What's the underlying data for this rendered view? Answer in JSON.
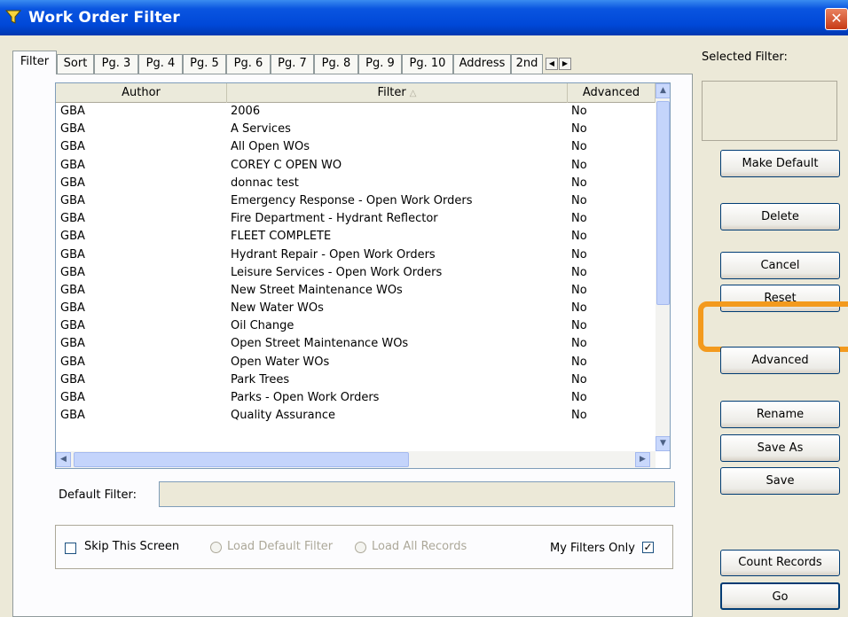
{
  "window": {
    "title": "Work Order Filter",
    "close_glyph": "✕"
  },
  "tabs": [
    "Filter",
    "Sort",
    "Pg. 3",
    "Pg. 4",
    "Pg. 5",
    "Pg. 6",
    "Pg. 7",
    "Pg. 8",
    "Pg. 9",
    "Pg. 10",
    "Address",
    "2nd"
  ],
  "active_tab": "Filter",
  "tab_scroll": {
    "left": "◀",
    "right": "▶"
  },
  "grid": {
    "columns": [
      "Author",
      "Filter",
      "Advanced"
    ],
    "sort_indicator": "△",
    "rows": [
      [
        "GBA",
        "2006",
        "No"
      ],
      [
        "GBA",
        "A Services",
        "No"
      ],
      [
        "GBA",
        "All Open WOs",
        "No"
      ],
      [
        "GBA",
        "COREY C OPEN WO",
        "No"
      ],
      [
        "GBA",
        "donnac test",
        "No"
      ],
      [
        "GBA",
        "Emergency Response - Open Work Orders",
        "No"
      ],
      [
        "GBA",
        "Fire Department - Hydrant Reflector",
        "No"
      ],
      [
        "GBA",
        "FLEET COMPLETE",
        "No"
      ],
      [
        "GBA",
        "Hydrant Repair - Open Work Orders",
        "No"
      ],
      [
        "GBA",
        "Leisure Services - Open Work Orders",
        "No"
      ],
      [
        "GBA",
        "New Street Maintenance WOs",
        "No"
      ],
      [
        "GBA",
        "New Water WOs",
        "No"
      ],
      [
        "GBA",
        "Oil Change",
        "No"
      ],
      [
        "GBA",
        "Open Street Maintenance WOs",
        "No"
      ],
      [
        "GBA",
        "Open Water WOs",
        "No"
      ],
      [
        "GBA",
        "Park Trees",
        "No"
      ],
      [
        "GBA",
        "Parks - Open Work Orders",
        "No"
      ],
      [
        "GBA",
        "Quality Assurance",
        "No"
      ]
    ]
  },
  "scroll_glyphs": {
    "up": "▲",
    "down": "▼",
    "left": "◀",
    "right": "▶"
  },
  "default_filter": {
    "label": "Default Filter:",
    "value": ""
  },
  "options": {
    "skip_screen": "Skip This Screen",
    "load_default": "Load Default Filter",
    "load_all": "Load All Records",
    "my_filters_only": "My Filters Only",
    "check_mark": "✓"
  },
  "selected_filter": {
    "label": "Selected Filter:",
    "value": ""
  },
  "buttons": {
    "make_default": "Make Default",
    "delete": "Delete",
    "cancel": "Cancel",
    "reset": "Reset",
    "advanced": "Advanced",
    "rename": "Rename",
    "save_as": "Save As",
    "save": "Save",
    "count_records": "Count Records",
    "go": "Go"
  },
  "colors": {
    "title_bar": "#0048d8",
    "highlight": "#f39a1e",
    "window_bg": "#ece9d8"
  }
}
